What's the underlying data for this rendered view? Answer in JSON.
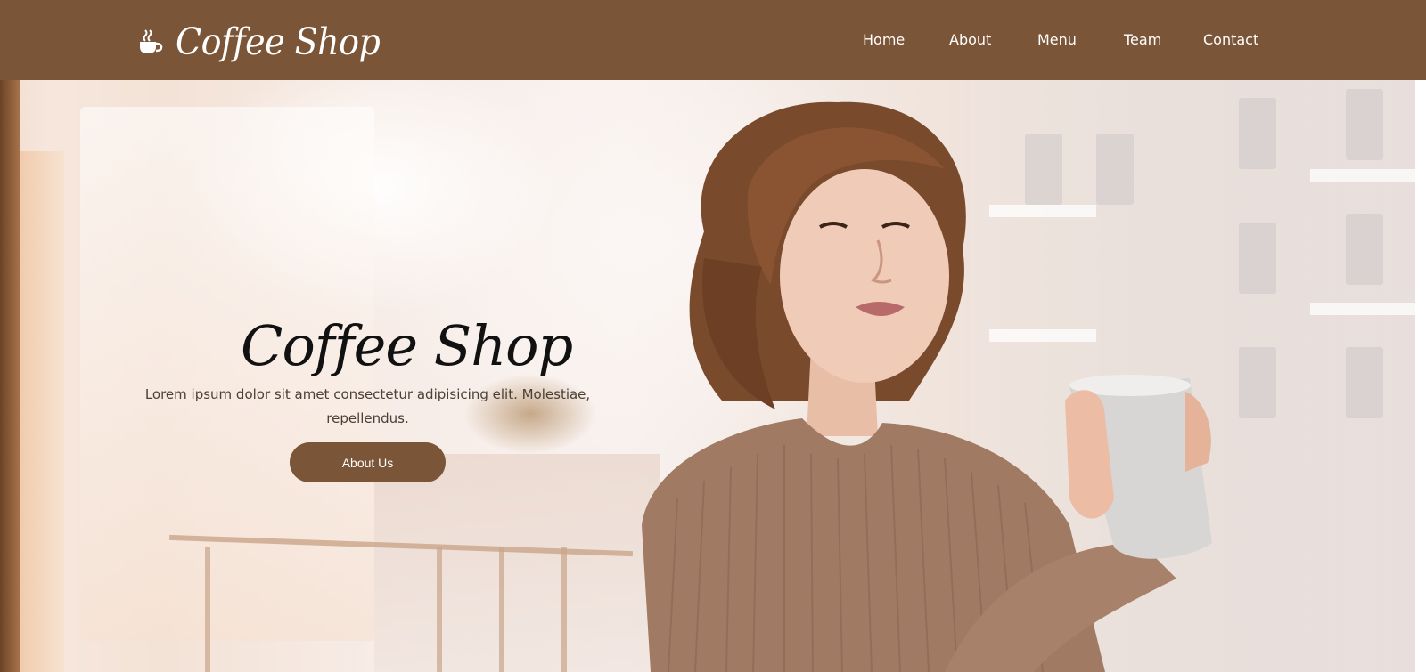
{
  "header": {
    "brand": "Coffee Shop",
    "nav": [
      {
        "label": "Home"
      },
      {
        "label": "About"
      },
      {
        "label": "Menu"
      },
      {
        "label": "Team"
      },
      {
        "label": "Contact"
      }
    ]
  },
  "hero": {
    "title": "Coffee Shop",
    "description": "Lorem ipsum dolor sit amet consectetur adipisicing elit. Molestiae, repellendus.",
    "button_label": "About Us"
  },
  "colors": {
    "brand": "#7b5537",
    "header_text": "#ffffff",
    "title_text": "#111111"
  },
  "icons": {
    "logo": "coffee-cup-icon",
    "title": "coffee-cup-icon"
  }
}
